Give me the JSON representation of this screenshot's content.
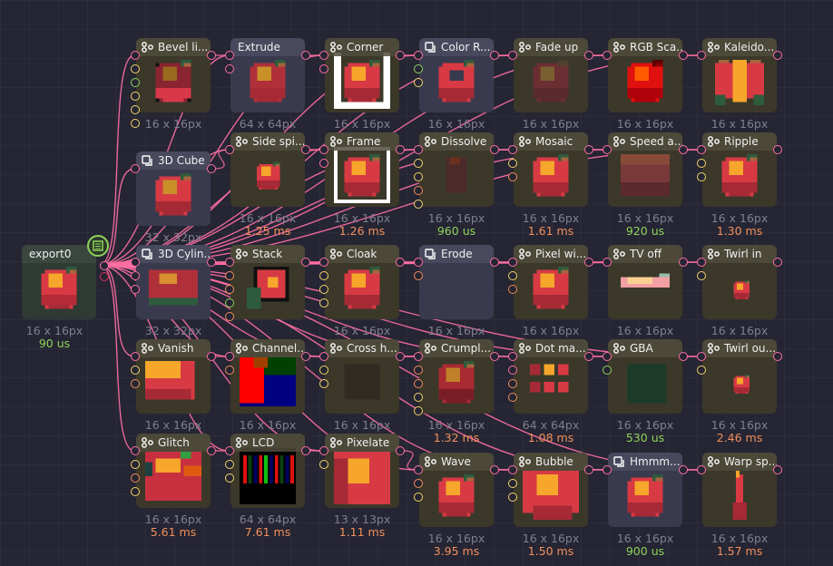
{
  "colors": {
    "background": "#252533",
    "wire": "#ff6fa3",
    "time_ms": "#f2905c",
    "time_us": "#8fd35b",
    "size_text": "#7f7f8f",
    "port_yellow": "#f4d46a",
    "port_green": "#8fd35b",
    "port_orange": "#f28d5a",
    "port_pink": "#ff6fa3"
  },
  "export_node": {
    "title": "export0",
    "size": "16 x 16px",
    "time": "90 us",
    "badge_icon": "export-settings-icon"
  },
  "nodes": [
    {
      "id": "bevel",
      "title": "Bevel li...",
      "icon": "shader-node-icon",
      "kind": "shader",
      "size": "16 x 16px",
      "time": "",
      "ports": [
        "p",
        "y",
        "g",
        "y",
        "y",
        "y"
      ],
      "preview": "bevel-apple"
    },
    {
      "id": "extrude",
      "title": "Extrude",
      "icon": "",
      "kind": "group",
      "size": "64 x 64px",
      "time": "",
      "ports": [
        "p",
        "p"
      ],
      "preview": "extrude-apple"
    },
    {
      "id": "corner",
      "title": "Corner",
      "icon": "shader-node-icon",
      "kind": "shader",
      "size": "16 x 16px",
      "time": "",
      "ports": [
        "p",
        "p"
      ],
      "preview": "corner-apple"
    },
    {
      "id": "color-r",
      "title": "Color R...",
      "icon": "group-node-icon",
      "kind": "group",
      "size": "16 x 16px",
      "time": "",
      "ports": [
        "p",
        "g",
        "y"
      ],
      "preview": "ring-apple"
    },
    {
      "id": "fade-up",
      "title": "Fade up",
      "icon": "shader-node-icon",
      "kind": "shader",
      "size": "16 x 16px",
      "time": "",
      "ports": [
        "p"
      ],
      "preview": "faded-apple"
    },
    {
      "id": "rgb-sca",
      "title": "RGB Sca...",
      "icon": "shader-node-icon",
      "kind": "shader",
      "size": "16 x 16px",
      "time": "",
      "ports": [
        "p"
      ],
      "preview": "rgb-apple"
    },
    {
      "id": "kaleido",
      "title": "Kaleido...",
      "icon": "shader-node-icon",
      "kind": "shader",
      "size": "16 x 16px",
      "time": "",
      "ports": [
        "p"
      ],
      "preview": "kaleido-apple"
    },
    {
      "id": "3d-cube",
      "title": "3D Cube",
      "icon": "group-node-icon",
      "kind": "group",
      "size": "32 x 32px",
      "time": "",
      "ports": [
        "p"
      ],
      "preview": "cube-apple"
    },
    {
      "id": "side-spi",
      "title": "Side spi...",
      "icon": "shader-node-icon",
      "kind": "shader",
      "size": "16 x 16px",
      "time": "1.25 ms",
      "ports": [
        "p"
      ],
      "preview": "small-apple"
    },
    {
      "id": "frame",
      "title": "Frame",
      "icon": "shader-node-icon",
      "kind": "shader",
      "size": "16 x 16px",
      "time": "1.26 ms",
      "ports": [
        "p",
        "p"
      ],
      "preview": "frame-apple"
    },
    {
      "id": "dissolve",
      "title": "Dissolve",
      "icon": "shader-node-icon",
      "kind": "shader",
      "size": "16 x 16px",
      "time": "960 us",
      "ports": [
        "p",
        "y",
        "y",
        "o",
        "y"
      ],
      "preview": "dissolve-apple"
    },
    {
      "id": "mosaic",
      "title": "Mosaic",
      "icon": "shader-node-icon",
      "kind": "shader",
      "size": "16 x 16px",
      "time": "1.61 ms",
      "ports": [
        "p",
        "y",
        "o"
      ],
      "preview": "mosaic-apple"
    },
    {
      "id": "speed-a",
      "title": "Speed a...",
      "icon": "shader-node-icon",
      "kind": "shader",
      "size": "16 x 16px",
      "time": "920 us",
      "ports": [
        "p"
      ],
      "preview": "blur-apple"
    },
    {
      "id": "ripple",
      "title": "Ripple",
      "icon": "shader-node-icon",
      "kind": "shader",
      "size": "16 x 16px",
      "time": "1.30 ms",
      "ports": [
        "p",
        "y",
        "y"
      ],
      "preview": "apple"
    },
    {
      "id": "3d-cylin",
      "title": "3D Cylin...",
      "icon": "group-node-icon",
      "kind": "group",
      "size": "32 x 32px",
      "time": "",
      "ports": [
        "p",
        "p",
        "p"
      ],
      "preview": "cylinder-apple"
    },
    {
      "id": "stack",
      "title": "Stack",
      "icon": "shader-node-icon",
      "kind": "shader",
      "size": "",
      "time": "",
      "ports": [
        "p",
        "o",
        "o",
        "g",
        "o"
      ],
      "preview": "stack-apple"
    },
    {
      "id": "cloak",
      "title": "Cloak",
      "icon": "shader-node-icon",
      "kind": "shader",
      "size": "16 x 16px",
      "time": "",
      "ports": [
        "p",
        "y",
        "y",
        "y"
      ],
      "preview": "apple"
    },
    {
      "id": "erode",
      "title": "Erode",
      "icon": "group-node-icon",
      "kind": "group",
      "size": "16 x 16px",
      "time": "",
      "ports": [
        "p",
        "o"
      ],
      "preview": "empty"
    },
    {
      "id": "pixel-wi",
      "title": "Pixel wi...",
      "icon": "shader-node-icon",
      "kind": "shader",
      "size": "16 x 16px",
      "time": "",
      "ports": [
        "p",
        "y",
        "o"
      ],
      "preview": "apple"
    },
    {
      "id": "tv-off",
      "title": "TV off",
      "icon": "shader-node-icon",
      "kind": "shader",
      "size": "16 x 16px",
      "time": "",
      "ports": [
        "p"
      ],
      "preview": "tv-apple"
    },
    {
      "id": "twirl-in",
      "title": "Twirl in",
      "icon": "shader-node-icon",
      "kind": "shader",
      "size": "16 x 16px",
      "time": "",
      "ports": [
        "p",
        "y"
      ],
      "preview": "tiny-apple"
    },
    {
      "id": "vanish",
      "title": "Vanish",
      "icon": "shader-node-icon",
      "kind": "shader",
      "size": "16 x 16px",
      "time": "",
      "ports": [
        "p",
        "y",
        "o"
      ],
      "preview": "vanish-apple"
    },
    {
      "id": "channel",
      "title": "Channel...",
      "icon": "shader-node-icon",
      "kind": "shader",
      "size": "16 x 16px",
      "time": "",
      "ports": [
        "p",
        "o"
      ],
      "preview": "channel-apple"
    },
    {
      "id": "cross-h",
      "title": "Cross h...",
      "icon": "shader-node-icon",
      "kind": "shader",
      "size": "16 x 16px",
      "time": "",
      "ports": [
        "p",
        "y",
        "y"
      ],
      "preview": "dark-apple"
    },
    {
      "id": "crumpl",
      "title": "Crumpl...",
      "icon": "shader-node-icon",
      "kind": "shader",
      "size": "16 x 16px",
      "time": "1.32 ms",
      "ports": [
        "p",
        "o",
        "o",
        "y",
        "y"
      ],
      "preview": "crumple-apple"
    },
    {
      "id": "dot-ma",
      "title": "Dot ma...",
      "icon": "shader-node-icon",
      "kind": "shader",
      "size": "64 x 64px",
      "time": "1.08 ms",
      "ports": [
        "p",
        "p",
        "o",
        "o"
      ],
      "preview": "dots"
    },
    {
      "id": "gba",
      "title": "GBA",
      "icon": "shader-node-icon",
      "kind": "shader",
      "size": "16 x 16px",
      "time": "530 us",
      "ports": [
        "p",
        "g"
      ],
      "preview": "gba-apple"
    },
    {
      "id": "twirl-ou",
      "title": "Twirl ou...",
      "icon": "shader-node-icon",
      "kind": "shader",
      "size": "16 x 16px",
      "time": "2.46 ms",
      "ports": [
        "p",
        "y"
      ],
      "preview": "tiny-apple"
    },
    {
      "id": "glitch",
      "title": "Glitch",
      "icon": "shader-node-icon",
      "kind": "shader",
      "size": "16 x 16px",
      "time": "5.61 ms",
      "ports": [
        "p",
        "y",
        "o",
        "y"
      ],
      "preview": "glitch-apple"
    },
    {
      "id": "lcd",
      "title": "LCD",
      "icon": "shader-node-icon",
      "kind": "shader",
      "size": "64 x 64px",
      "time": "7.61 ms",
      "ports": [
        "p",
        "y",
        "y"
      ],
      "preview": "lcd"
    },
    {
      "id": "pixelate",
      "title": "Pixelate",
      "icon": "shader-node-icon",
      "kind": "shader",
      "size": "13 x 13px",
      "time": "1.11 ms",
      "ports": [
        "p",
        "y"
      ],
      "preview": "pixelate"
    },
    {
      "id": "wave",
      "title": "Wave",
      "icon": "shader-node-icon",
      "kind": "shader",
      "size": "16 x 16px",
      "time": "3.95 ms",
      "ports": [
        "p",
        "o",
        "y"
      ],
      "preview": "wave-apple"
    },
    {
      "id": "bubble",
      "title": "Bubble",
      "icon": "shader-node-icon",
      "kind": "shader",
      "size": "16 x 16px",
      "time": "1.50 ms",
      "ports": [
        "p",
        "y",
        "y"
      ],
      "preview": "bubble-apple"
    },
    {
      "id": "hmmm",
      "title": "Hmmm...",
      "icon": "group-node-icon",
      "kind": "group",
      "size": "16 x 16px",
      "time": "900 us",
      "ports": [
        "p"
      ],
      "preview": "apple"
    },
    {
      "id": "warp-sp",
      "title": "Warp sp...",
      "icon": "shader-node-icon",
      "kind": "shader",
      "size": "16 x 16px",
      "time": "1.57 ms",
      "ports": [
        "p"
      ],
      "preview": "warp"
    }
  ]
}
